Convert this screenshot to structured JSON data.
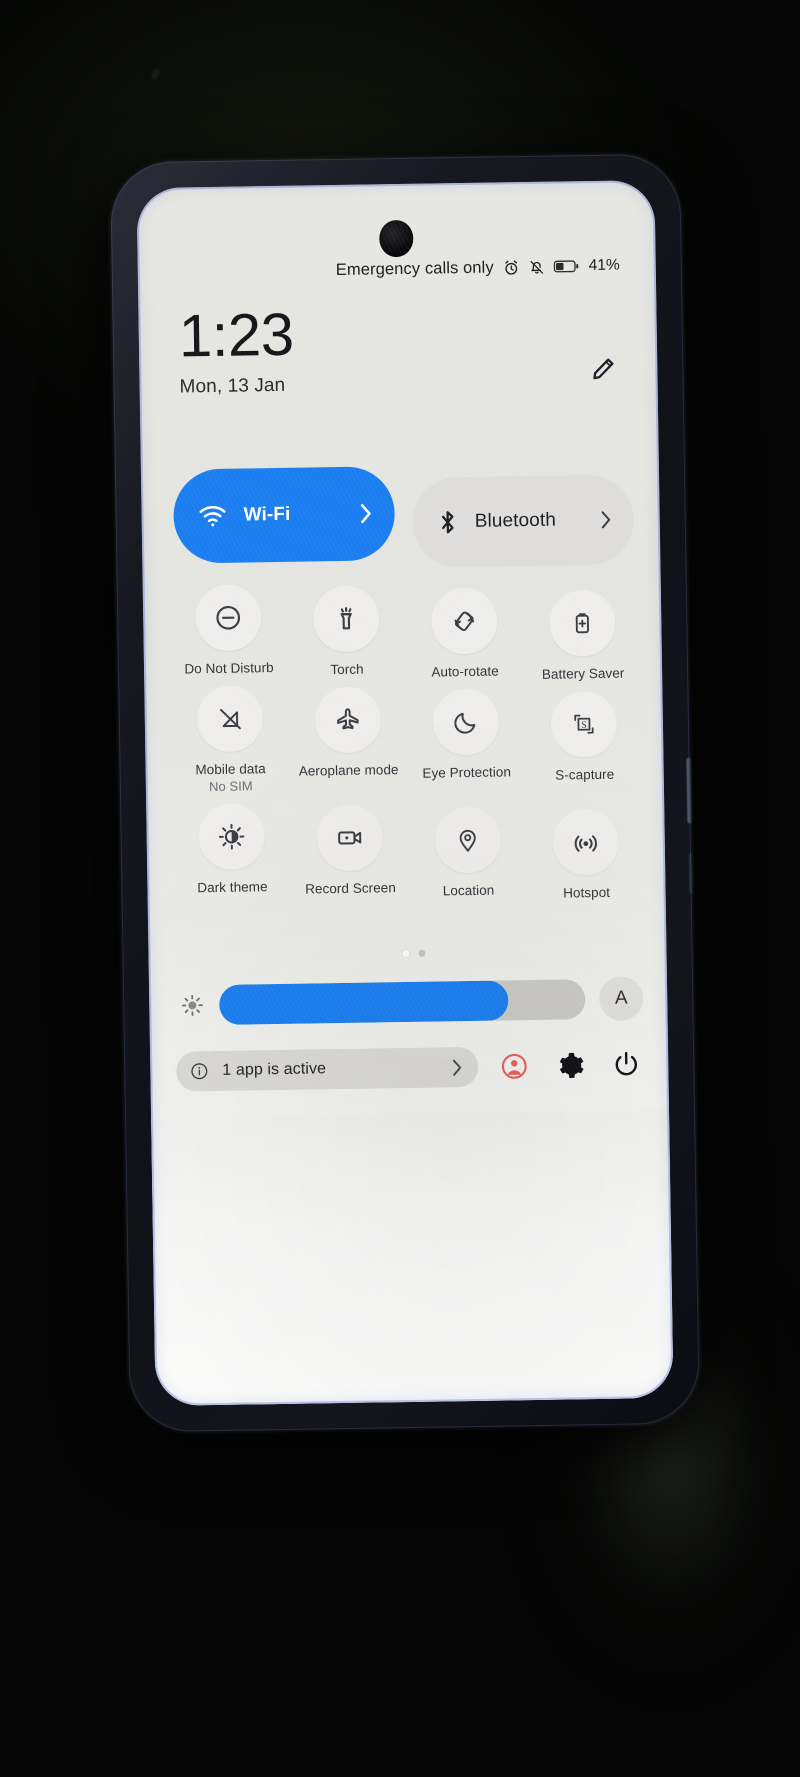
{
  "device": {
    "type": "android-phone",
    "screen_background": "#e8e8e5",
    "bezel_color": "#14151d"
  },
  "status_bar": {
    "carrier_text": "Emergency calls only",
    "icons": [
      "alarm-icon",
      "notifications-muted-icon",
      "battery-icon"
    ],
    "battery_percent": "41%"
  },
  "header": {
    "time": "1:23",
    "date": "Mon, 13 Jan",
    "edit_icon": "pencil-icon"
  },
  "big_tiles": [
    {
      "label": "Wi-Fi",
      "icon": "wifi-icon",
      "state": "on",
      "chevron": "chevron-right-icon"
    },
    {
      "label": "Bluetooth",
      "icon": "bluetooth-icon",
      "state": "off",
      "chevron": "chevron-right-icon"
    }
  ],
  "toggle_grid": {
    "rows": [
      [
        {
          "label": "Do Not Disturb",
          "sub": "",
          "icon": "do-not-disturb-icon",
          "state": "off"
        },
        {
          "label": "Torch",
          "sub": "",
          "icon": "torch-icon",
          "state": "off"
        },
        {
          "label": "Auto-rotate",
          "sub": "",
          "icon": "auto-rotate-icon",
          "state": "off"
        },
        {
          "label": "Battery Saver",
          "sub": "",
          "icon": "battery-saver-icon",
          "state": "off"
        }
      ],
      [
        {
          "label": "Mobile data",
          "sub": "No SIM",
          "icon": "mobile-data-off-icon",
          "state": "off"
        },
        {
          "label": "Aeroplane mode",
          "sub": "",
          "icon": "aeroplane-icon",
          "state": "off"
        },
        {
          "label": "Eye Protection",
          "sub": "",
          "icon": "moon-icon",
          "state": "off"
        },
        {
          "label": "S-capture",
          "sub": "",
          "icon": "s-capture-icon",
          "state": "off"
        }
      ],
      [
        {
          "label": "Dark theme",
          "sub": "",
          "icon": "dark-theme-icon",
          "state": "off"
        },
        {
          "label": "Record Screen",
          "sub": "",
          "icon": "record-screen-icon",
          "state": "off"
        },
        {
          "label": "Location",
          "sub": "",
          "icon": "location-pin-icon",
          "state": "off"
        },
        {
          "label": "Hotspot",
          "sub": "",
          "icon": "hotspot-icon",
          "state": "off"
        }
      ]
    ]
  },
  "page_indicator": {
    "total": 2,
    "active_index": 0
  },
  "brightness": {
    "icon": "brightness-icon",
    "level_percent": 79,
    "auto_label": "A"
  },
  "bottom_bar": {
    "active_apps_icon": "info-icon",
    "active_apps_text": "1 app is active",
    "active_apps_chevron": "chevron-right-icon",
    "buttons": [
      {
        "name": "user-account-icon",
        "color": "#e8605a"
      },
      {
        "name": "settings-gear-icon",
        "color": "#121216"
      },
      {
        "name": "power-icon",
        "color": "#121216"
      }
    ]
  },
  "colors": {
    "accent_blue": "#1b7ef0",
    "tile_off": "#dedddb",
    "circle_off": "#eeedeb",
    "text_primary": "#16161a",
    "text_secondary": "#6c6c74",
    "user_red": "#e8605a"
  }
}
